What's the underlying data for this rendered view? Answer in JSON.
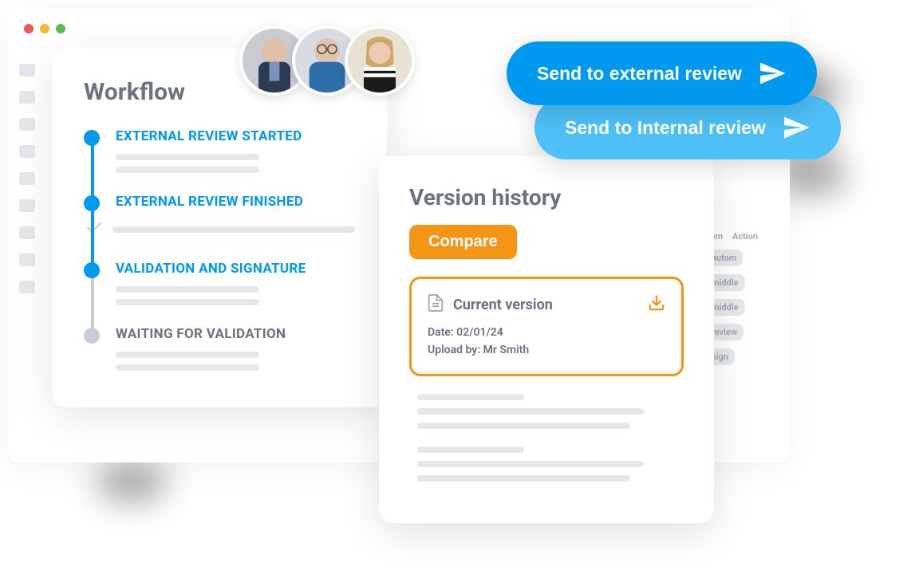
{
  "workflow": {
    "title": "Workflow",
    "steps": [
      {
        "label": "EXTERNAL REVIEW STARTED",
        "active": true
      },
      {
        "label": "EXTERNAL REVIEW FINISHED",
        "active": true
      },
      {
        "label": "VALIDATION AND SIGNATURE",
        "active": true
      },
      {
        "label": "WAITING FOR VALIDATION",
        "active": false
      }
    ]
  },
  "buttons": {
    "external": "Send to external review",
    "internal": "Send to Internal review",
    "compare": "Compare"
  },
  "versionHistory": {
    "title": "Version history",
    "current": {
      "label": "Current version",
      "dateLabel": "Date: 02/01/24",
      "uploadLabel": "Upload by: Mr Smith"
    }
  },
  "bgHeader": {
    "col1": "item",
    "col2": "Action"
  },
  "bgChips": [
    "autom",
    "middle",
    "middle",
    "review",
    "sign"
  ],
  "avatars": [
    "avatar-1",
    "avatar-2",
    "avatar-3"
  ],
  "colors": {
    "primary": "#0099f0",
    "primaryLight": "#4cc0f7",
    "accent": "#f59516",
    "grey": "#6b7280"
  }
}
